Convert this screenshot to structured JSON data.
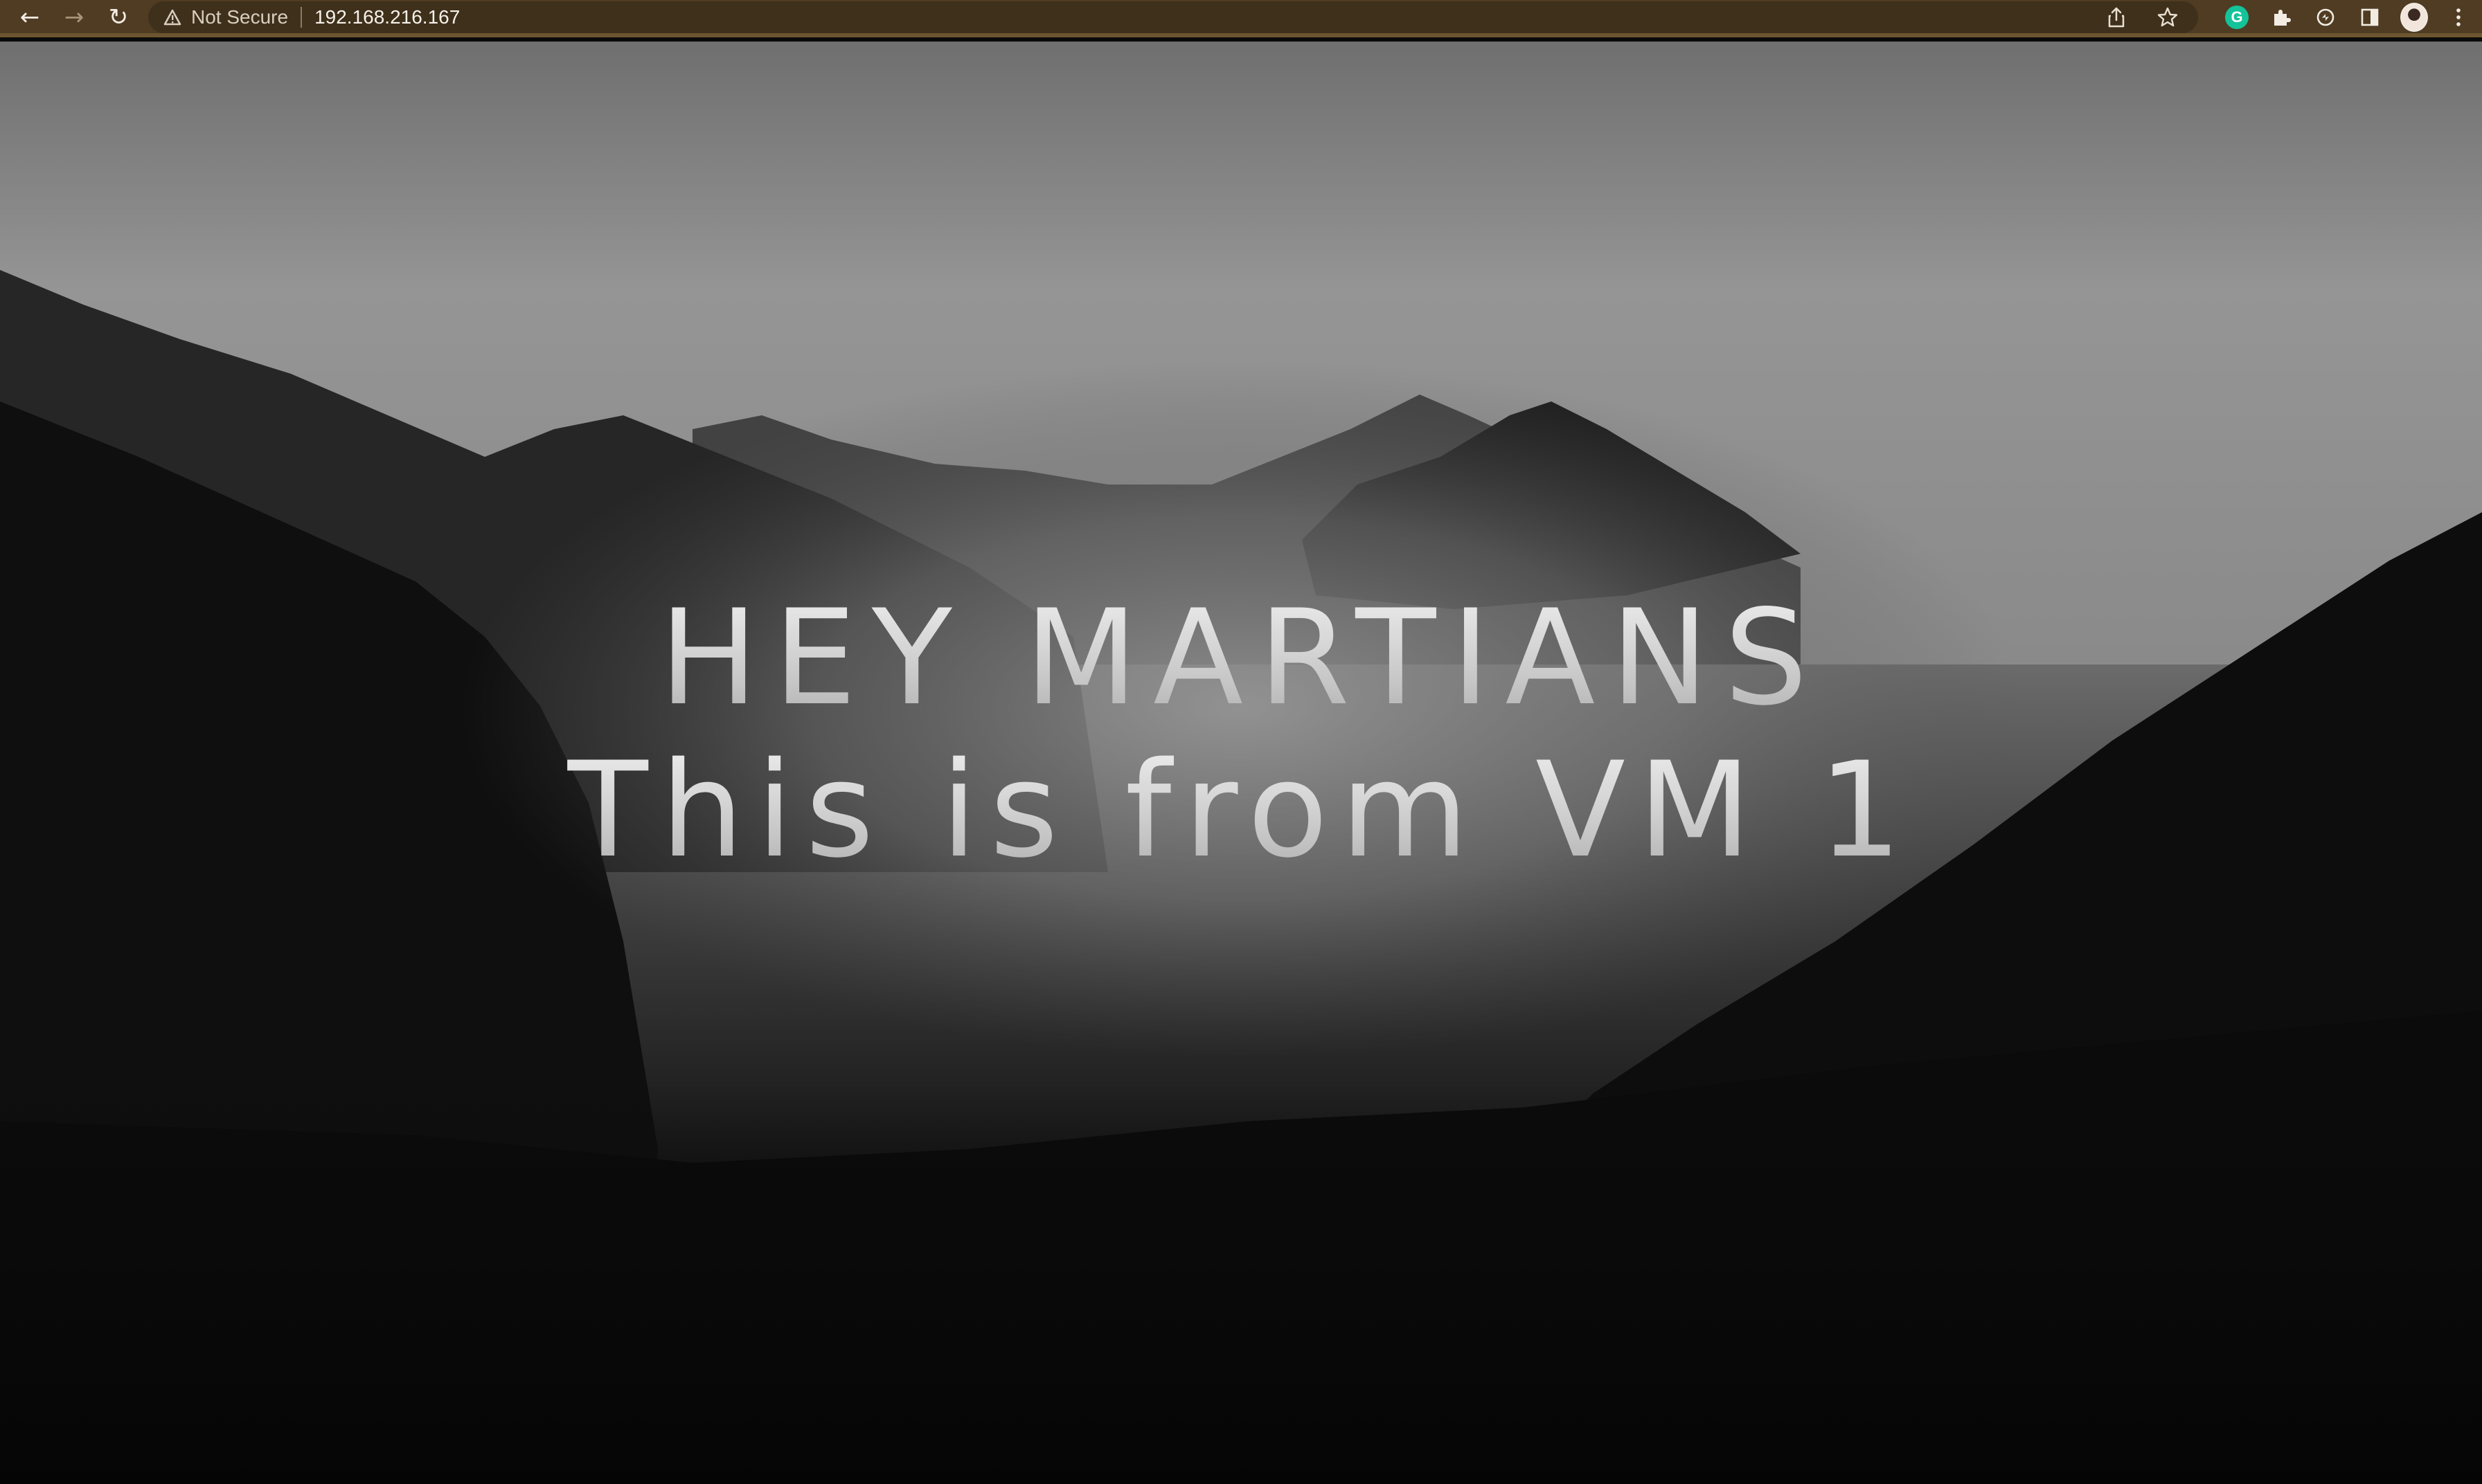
{
  "browser": {
    "nav": {
      "back_icon": "arrow-left-icon",
      "forward_icon": "arrow-right-icon",
      "reload_icon": "reload-icon"
    },
    "address_bar": {
      "security_label": "Not Secure",
      "url": "192.168.216.167"
    },
    "toolbar_icons": [
      "share-icon",
      "star-icon",
      "grammarly-icon",
      "extensions-icon",
      "sync-icon",
      "side-panel-icon",
      "avatar",
      "menu-icon"
    ],
    "grammarly_letter": "G",
    "colors": {
      "toolbar": "#4f3c23",
      "omnibox": "#3f301b"
    }
  },
  "page": {
    "heading_line_1": "HEY MARTIANS",
    "heading_line_2": "This is from VM 1",
    "background": "misty-forest-mountains-grayscale"
  }
}
